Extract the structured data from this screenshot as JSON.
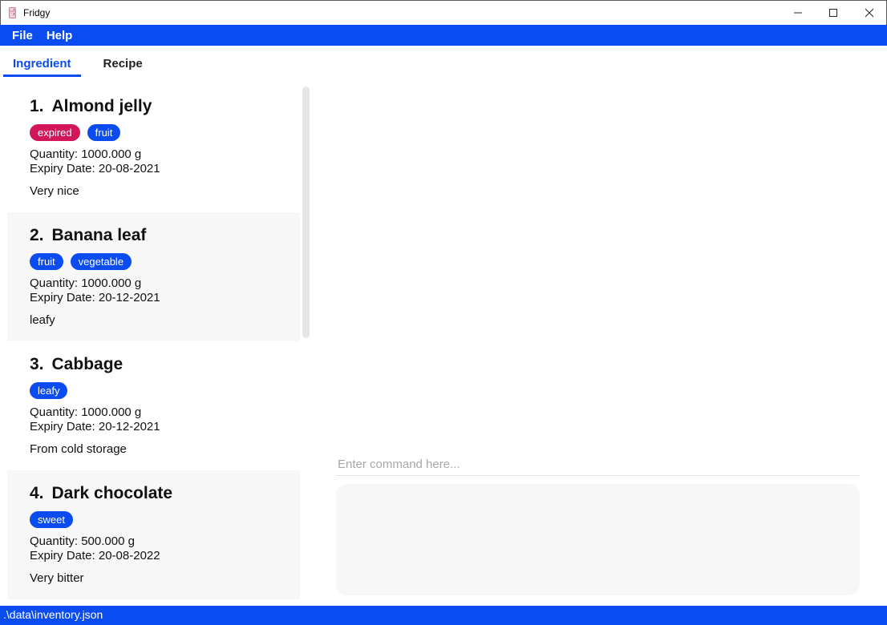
{
  "window": {
    "title": "Fridgy",
    "minimize_glyph": "—",
    "maximize_glyph": "☐",
    "close_glyph": "✕"
  },
  "menu": {
    "file": "File",
    "help": "Help"
  },
  "tabs": {
    "ingredient": "Ingredient",
    "recipe": "Recipe"
  },
  "ingredients": [
    {
      "index": "1.",
      "name": "Almond jelly",
      "tags": [
        "expired",
        "fruit"
      ],
      "quantity": "Quantity: 1000.000 g",
      "expiry": "Expiry Date: 20-08-2021",
      "description": "Very nice"
    },
    {
      "index": "2.",
      "name": "Banana leaf",
      "tags": [
        "fruit",
        "vegetable"
      ],
      "quantity": "Quantity: 1000.000 g",
      "expiry": "Expiry Date: 20-12-2021",
      "description": "leafy"
    },
    {
      "index": "3.",
      "name": "Cabbage",
      "tags": [
        "leafy"
      ],
      "quantity": "Quantity: 1000.000 g",
      "expiry": "Expiry Date: 20-12-2021",
      "description": "From cold storage"
    },
    {
      "index": "4.",
      "name": "Dark chocolate",
      "tags": [
        "sweet"
      ],
      "quantity": "Quantity: 500.000 g",
      "expiry": "Expiry Date: 20-08-2022",
      "description": "Very bitter"
    }
  ],
  "command": {
    "value": "",
    "placeholder": "Enter command here..."
  },
  "status": {
    "path": ".\\data\\inventory.json"
  },
  "colors": {
    "accent": "#0a4cf0",
    "expired": "#d3165a",
    "card_alt": "#f7f7f7"
  },
  "icons": {
    "app": "fridge-icon"
  }
}
